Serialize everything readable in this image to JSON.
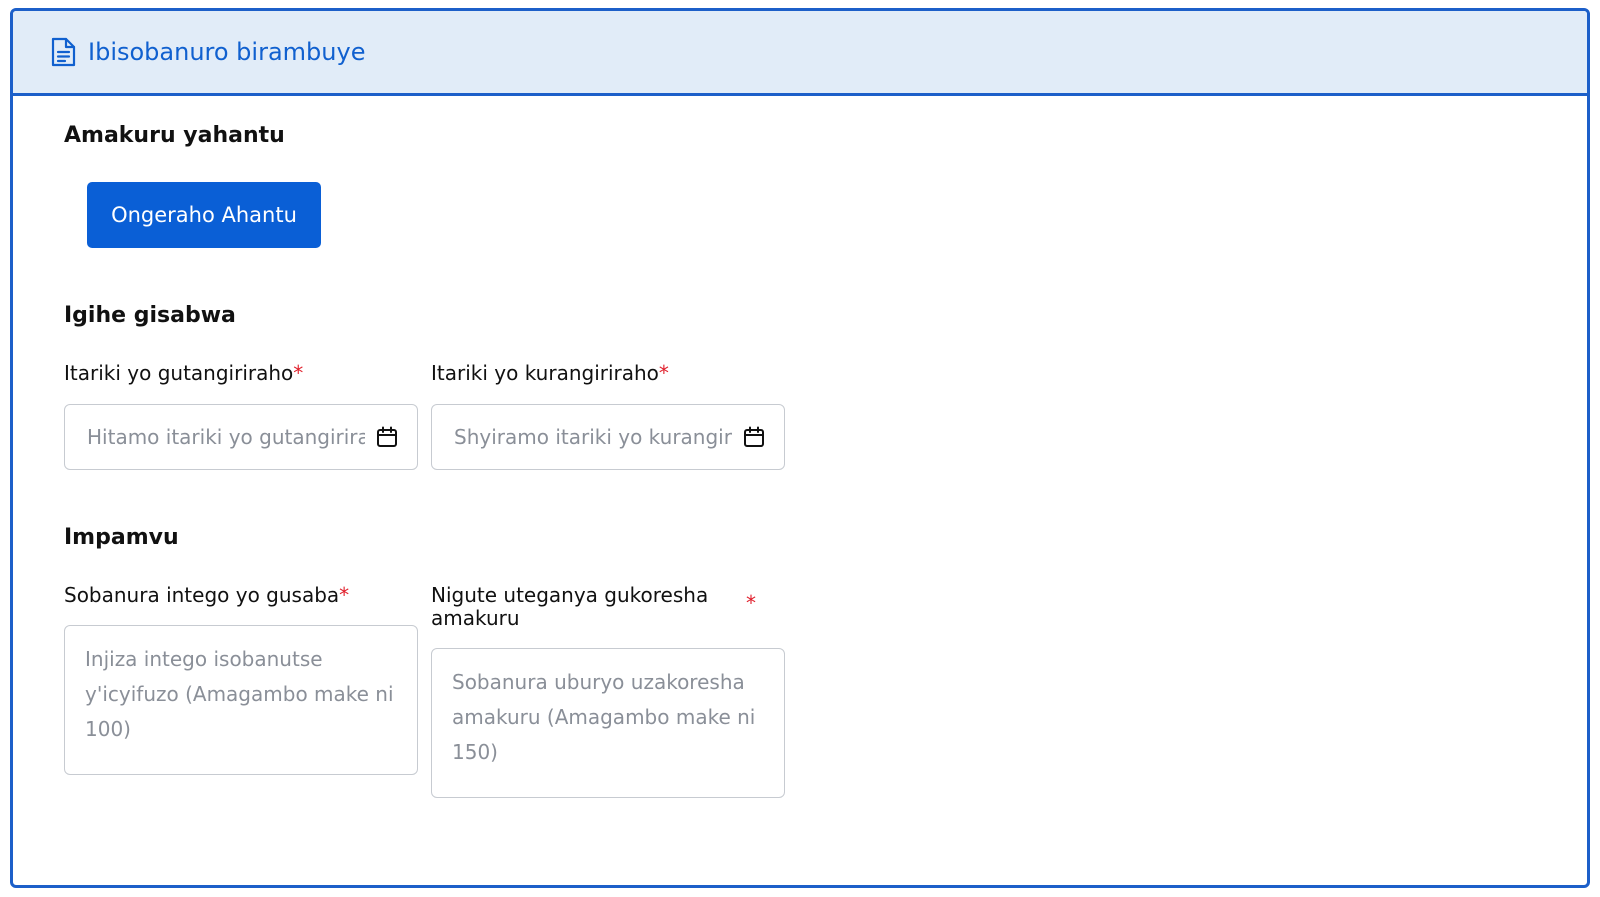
{
  "header": {
    "title": "Ibisobanuro birambuye",
    "icon": "document-icon",
    "accent_color": "#1060cf",
    "background_color": "#e1ecf8"
  },
  "location_section": {
    "title": "Amakuru yahantu",
    "add_button_label": "Ongeraho Ahantu",
    "button_color": "#0a5fd6"
  },
  "period_section": {
    "title": "Igihe gisabwa",
    "start_date": {
      "label": "Itariki yo gutangiriraho",
      "required_mark": "*",
      "placeholder": "Hitamo itariki yo gutangiriraho",
      "value": "",
      "icon": "calendar-icon"
    },
    "end_date": {
      "label": "Itariki yo kurangiriraho",
      "required_mark": "*",
      "placeholder": "Shyiramo itariki yo kurangiriraho",
      "value": "",
      "icon": "calendar-icon"
    }
  },
  "reason_section": {
    "title": "Impamvu",
    "purpose": {
      "label": "Sobanura intego yo gusaba",
      "required_mark": "*",
      "placeholder": "Injiza intego isobanutse y'icyifuzo (Amagambo make ni 100)",
      "value": ""
    },
    "usage": {
      "label": "Nigute uteganya gukoresha amakuru",
      "required_mark": "*",
      "placeholder": "Sobanura uburyo uzakoresha amakuru (Amagambo make ni 150)",
      "value": ""
    }
  },
  "required_color": "#e0202c"
}
